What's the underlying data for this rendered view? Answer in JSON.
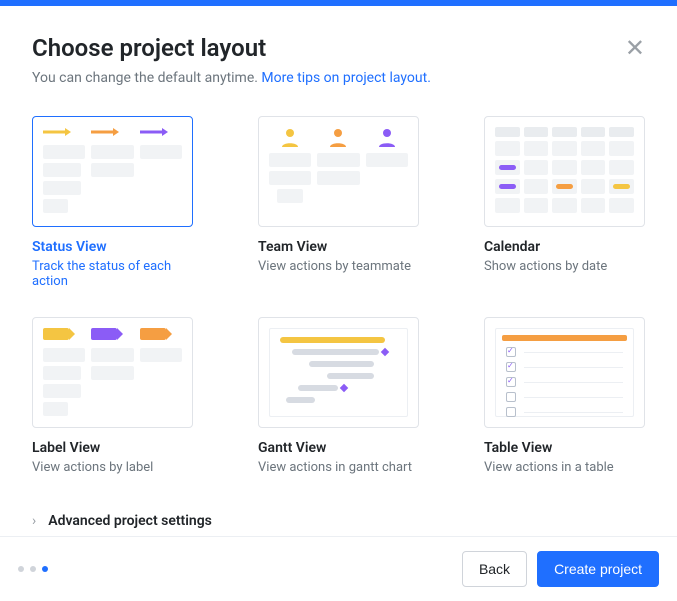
{
  "header": {
    "title": "Choose project layout",
    "subtitle_prefix": "You can change the default anytime. ",
    "subtitle_link": "More tips on project layout."
  },
  "layouts": [
    {
      "key": "status",
      "title": "Status View",
      "desc": "Track the status of each action",
      "selected": true
    },
    {
      "key": "team",
      "title": "Team View",
      "desc": "View actions by teammate",
      "selected": false
    },
    {
      "key": "calendar",
      "title": "Calendar",
      "desc": "Show actions by date",
      "selected": false
    },
    {
      "key": "label",
      "title": "Label View",
      "desc": "View actions by label",
      "selected": false
    },
    {
      "key": "gantt",
      "title": "Gantt View",
      "desc": "View actions in gantt chart",
      "selected": false
    },
    {
      "key": "table",
      "title": "Table View",
      "desc": "View actions in a table",
      "selected": false
    }
  ],
  "advanced": {
    "label": "Advanced project settings"
  },
  "footer": {
    "back_label": "Back",
    "create_label": "Create project",
    "step_count": 3,
    "active_step": 3
  },
  "colors": {
    "primary": "#1f6fff",
    "yellow": "#f4c542",
    "orange": "#f59e42",
    "purple": "#8b5cf6"
  }
}
